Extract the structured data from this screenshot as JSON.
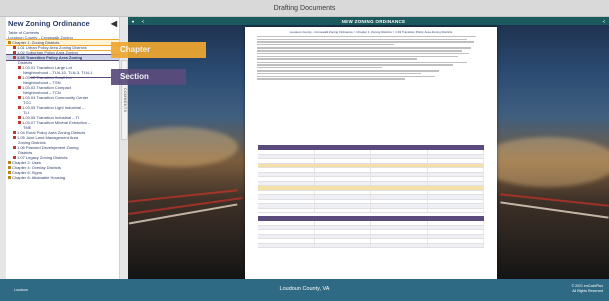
{
  "app": {
    "title": "Drafting Documents"
  },
  "sidebar": {
    "title": "New Zoning Ordinance",
    "collapse_icon": "caret-left-icon",
    "items": [
      {
        "label": "Table of Contents",
        "indent": 0,
        "type": "doc"
      },
      {
        "label": "Loudoun County - Crosswalk Zoning",
        "indent": 0,
        "type": "doc"
      },
      {
        "label": "Chapter 1: Zoning Districts",
        "indent": 0,
        "type": "fold",
        "state": "chapter"
      },
      {
        "label": "1.01 Urban Policy Area Zoning Districts",
        "indent": 1,
        "type": "red"
      },
      {
        "label": "1.02 Suburban Policy Area Zoning",
        "indent": 1,
        "type": "red"
      },
      {
        "label": "1.03 Transition Policy Area Zoning",
        "indent": 1,
        "type": "red",
        "state": "section"
      },
      {
        "label": "Districts",
        "indent": 2,
        "type": "none"
      },
      {
        "label": "1.03.01 Transition Large Lot",
        "indent": 2,
        "type": "red"
      },
      {
        "label": "Neighborhood – TLN-10, TLN-3, TLN-1",
        "indent": 3,
        "type": "none"
      },
      {
        "label": "1.03.02 Transition Small Lot",
        "indent": 2,
        "type": "red"
      },
      {
        "label": "Neighborhood – TSN",
        "indent": 3,
        "type": "none"
      },
      {
        "label": "1.03.03 Transition Compact",
        "indent": 2,
        "type": "red"
      },
      {
        "label": "Neighborhood – TCN",
        "indent": 3,
        "type": "none"
      },
      {
        "label": "1.03.04 Transition Community Center",
        "indent": 2,
        "type": "red"
      },
      {
        "label": "TCC",
        "indent": 3,
        "type": "none"
      },
      {
        "label": "1.03.05 Transition Light Industrial –",
        "indent": 2,
        "type": "red"
      },
      {
        "label": "TLI",
        "indent": 3,
        "type": "none"
      },
      {
        "label": "1.03.06 Transition Industrial – TI",
        "indent": 2,
        "type": "red"
      },
      {
        "label": "1.03.07 Transition Mineral Extraction –",
        "indent": 2,
        "type": "red"
      },
      {
        "label": "TME",
        "indent": 3,
        "type": "none"
      },
      {
        "label": "1.04 Rural Policy Area Zoning Districts",
        "indent": 1,
        "type": "red"
      },
      {
        "label": "1.05 Joint Land Management Area",
        "indent": 1,
        "type": "red"
      },
      {
        "label": "Zoning Districts",
        "indent": 2,
        "type": "none"
      },
      {
        "label": "1.06 Planned Development Zoning",
        "indent": 1,
        "type": "red"
      },
      {
        "label": "Districts",
        "indent": 2,
        "type": "none"
      },
      {
        "label": "1.07 Legacy Zoning Districts",
        "indent": 1,
        "type": "red"
      },
      {
        "label": "Chapter 2: Uses",
        "indent": 0,
        "type": "fold"
      },
      {
        "label": "Chapter 4: Overlay Districts",
        "indent": 0,
        "type": "fold"
      },
      {
        "label": "Chapter 6: Signs",
        "indent": 0,
        "type": "fold"
      },
      {
        "label": "Chapter 8: Attainable Housing",
        "indent": 0,
        "type": "fold"
      }
    ]
  },
  "comments_tab": {
    "label": "COMMENTS"
  },
  "viewer": {
    "toolbar_title": "NEW ZONING ORDINANCE",
    "left_icons": [
      "list-icon",
      "share-icon"
    ],
    "right_icon": "share-icon",
    "breadcrumb": "Loudoun County - Crosswalk Zoning Ordinance > Chapter 1: Zoning Districts > 1.03 Transition Policy Area Zoning Districts"
  },
  "callouts": {
    "chapter": "Chapter",
    "section": "Section"
  },
  "colors": {
    "chapter": "#f0a830",
    "section": "#5a4b7c",
    "toolbar": "#1b5b5e",
    "footer": "#2f6a85"
  },
  "footer": {
    "center": "Loudoun County, VA",
    "logo": "Loudoun",
    "right_line1": "© 2021 enCodePlus",
    "right_line2": "All Rights Reserved"
  }
}
